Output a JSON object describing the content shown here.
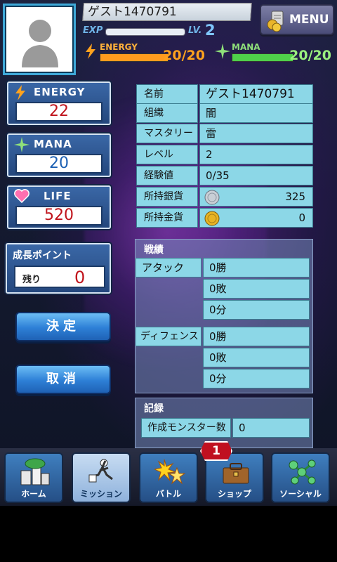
{
  "header": {
    "player_name": "ゲスト1470791",
    "exp_label": "EXP",
    "exp_progress": 0.0,
    "lv_label": "LV.",
    "level_value": "2",
    "menu_label": "MENU",
    "energy": {
      "label": "ENERGY",
      "value": "20/20",
      "fill": 1.0
    },
    "mana": {
      "label": "MANA",
      "value": "20/20",
      "fill": 1.0
    }
  },
  "stats": {
    "energy": {
      "label": "ENERGY",
      "value": "22"
    },
    "mana": {
      "label": "MANA",
      "value": "20"
    },
    "life": {
      "label": "LIFE",
      "value": "520"
    }
  },
  "growth": {
    "label": "成長ポイント",
    "remaining_label": "残り",
    "value": "0"
  },
  "buttons": {
    "confirm": "決定",
    "cancel": "取消"
  },
  "profile": {
    "rows": [
      {
        "key": "名前",
        "value": "ゲスト1470791"
      },
      {
        "key": "組織",
        "value": "闇"
      },
      {
        "key": "マスタリー",
        "value": "雷"
      },
      {
        "key": "レベル",
        "value": "2"
      },
      {
        "key": "経験値",
        "value": "0/35"
      },
      {
        "key": "所持銀貨",
        "value": "325"
      },
      {
        "key": "所持金貨",
        "value": "0"
      }
    ]
  },
  "battle": {
    "title": "戦績",
    "attack_label": "アタック",
    "attack": [
      "0勝",
      "0敗",
      "0分"
    ],
    "defense_label": "ディフェンス",
    "defense": [
      "0勝",
      "0敗",
      "0分"
    ]
  },
  "record": {
    "title": "記録",
    "monsters_label": "作成モンスター数",
    "monsters_value": "0"
  },
  "nav": {
    "items": [
      {
        "label": "ホーム"
      },
      {
        "label": "ミッション"
      },
      {
        "label": "バトル"
      },
      {
        "label": "ショップ"
      },
      {
        "label": "ソーシャル"
      }
    ],
    "badge": "1",
    "active": "ミッション"
  },
  "colors": {
    "accent": "#3fa9d8",
    "energy": "#ff9b1e",
    "mana": "#4fd04a",
    "value_red": "#c0141c",
    "value_blue": "#1b5fb3"
  }
}
